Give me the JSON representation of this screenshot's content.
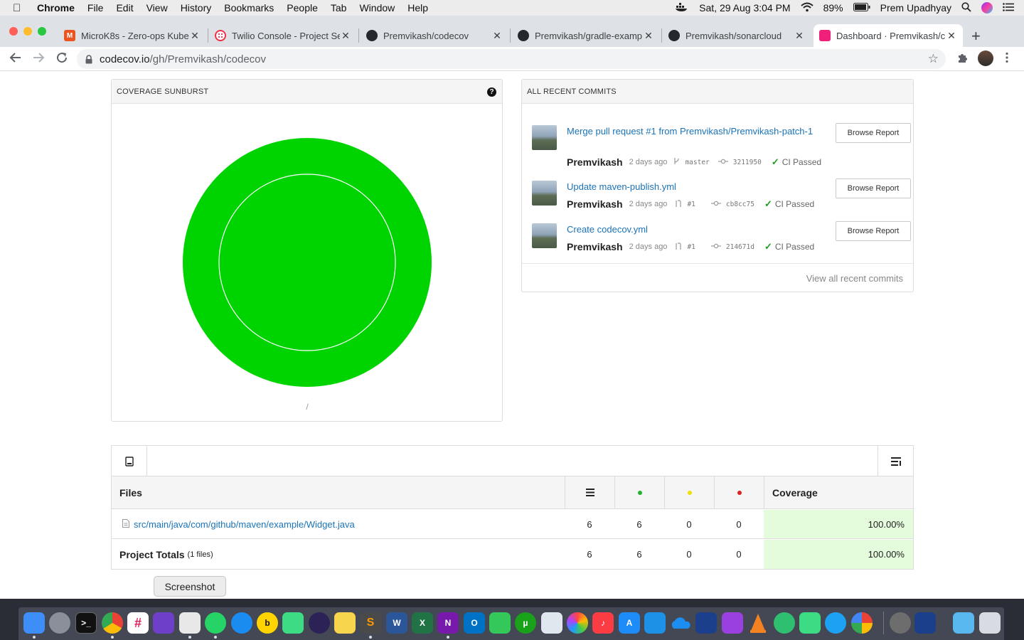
{
  "menubar": {
    "app": "Chrome",
    "items": [
      "File",
      "Edit",
      "View",
      "History",
      "Bookmarks",
      "People",
      "Tab",
      "Window",
      "Help"
    ],
    "datetime": "Sat, 29 Aug  3:04 PM",
    "battery": "89%",
    "user": "Prem Upadhyay"
  },
  "tabs": [
    {
      "title": "MicroK8s - Zero-ops Kube",
      "favicon": "M",
      "color": "#e95420"
    },
    {
      "title": "Twilio Console - Project Se",
      "favicon": "",
      "color": "#f22f46"
    },
    {
      "title": "Premvikash/codecov",
      "favicon": "",
      "color": "#24292e"
    },
    {
      "title": "Premvikash/gradle-examp",
      "favicon": "",
      "color": "#24292e"
    },
    {
      "title": "Premvikash/sonarcloud",
      "favicon": "",
      "color": "#24292e"
    },
    {
      "title": "Dashboard · Premvikash/c",
      "favicon": "",
      "color": "#f01f7a",
      "active": true
    }
  ],
  "address": {
    "host": "codecov.io",
    "path": "/gh/Premvikash/codecov"
  },
  "sunburst": {
    "header": "COVERAGE SUNBURST",
    "path_label": "/",
    "fill_color": "#00d400",
    "coverage_fraction": 1.0
  },
  "recent_commits": {
    "header": "ALL RECENT COMMITS",
    "view_all": "View all recent commits",
    "browse_label": "Browse Report",
    "items": [
      {
        "title": "Merge pull request #1 from Premvikash/Premvikash-patch-1",
        "author": "Premvikash",
        "age": "2 days ago",
        "ref": "master",
        "sha": "3211950",
        "status": "CI Passed"
      },
      {
        "title": "Update maven-publish.yml",
        "author": "Premvikash",
        "age": "2 days ago",
        "ref": "#1",
        "sha": "cb8cc75",
        "status": "CI Passed"
      },
      {
        "title": "Create codecov.yml",
        "author": "Premvikash",
        "age": "2 days ago",
        "ref": "#1",
        "sha": "214671d",
        "status": "CI Passed"
      }
    ]
  },
  "files": {
    "headers": {
      "name": "Files",
      "coverage": "Coverage"
    },
    "dot_colors": {
      "hit": "#21b12c",
      "partial": "#f0e000",
      "miss": "#e02020"
    },
    "rows": [
      {
        "name": "src/main/java/com/github/maven/example/Widget.java",
        "lines": "6",
        "hits": "6",
        "partials": "0",
        "misses": "0",
        "coverage": "100.00%"
      }
    ],
    "totals": {
      "label": "Project Totals",
      "count": "(1 files)",
      "lines": "6",
      "hits": "6",
      "partials": "0",
      "misses": "0",
      "coverage": "100.00%"
    }
  },
  "tooltip": "Screenshot"
}
